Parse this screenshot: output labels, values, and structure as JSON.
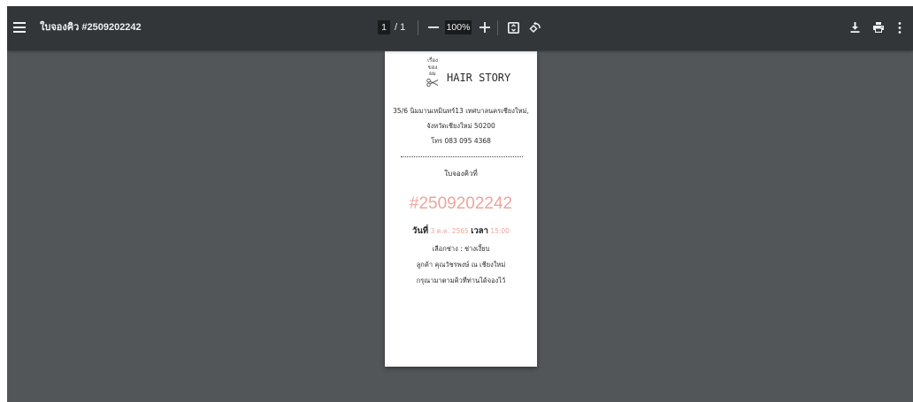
{
  "window": {
    "title": "ใบจองคิว #2509202242"
  },
  "toolbar": {
    "page_current": "1",
    "page_total": "/ 1",
    "zoom": "100%"
  },
  "icons": {
    "menu": "menu-icon",
    "zoom_out": "minus-icon",
    "zoom_in": "plus-icon",
    "fit": "fit-to-page-icon",
    "rotate": "rotate-counterclockwise-icon",
    "download": "download-icon",
    "print": "print-icon",
    "more": "more-vert-icon",
    "logo": "scissors-icon"
  },
  "colors": {
    "toolbar_bg": "#323639",
    "viewer_bg": "#525659",
    "accent_pink": "#eba59d",
    "text_dark": "#2b2b2b"
  },
  "receipt": {
    "logo_lines": [
      "เรื่อง",
      "ของ",
      "ผม"
    ],
    "brand": "HAIR STORY",
    "address_line1": "35/6 นิมมานเหมินทร์13 เทศบาลนครเชียงใหม่,",
    "address_line2": "จังหวัดเชียงใหม่ 50200",
    "phone": "โทร 083 095 4368",
    "heading": "ใบจองคิวที่",
    "queue_number": "#2509202242",
    "date_label": "วันที่",
    "date_value": "3 ต.ค. 2565",
    "time_label": "เวลา",
    "time_value": "15:00",
    "stylist": "เลือกช่าง : ช่างเงี้ยบ",
    "customer": "ลูกค้า คุณวัชรพงษ์ ณ เชียงใหม่",
    "note": "กรุณามาตามคิวที่ท่านได้จองไว้"
  }
}
